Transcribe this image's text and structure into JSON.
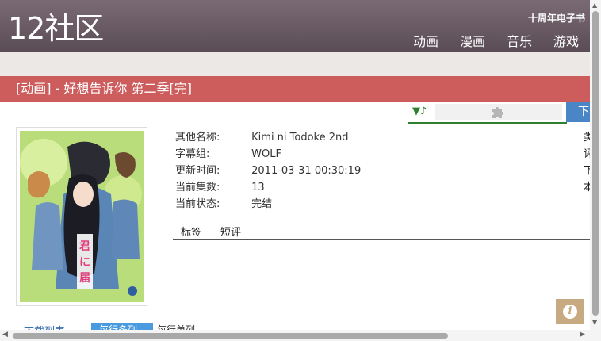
{
  "header": {
    "logo": "12社区",
    "anniversary": "十周年电子书",
    "nav": [
      "动画",
      "漫画",
      "音乐",
      "游戏"
    ]
  },
  "page_title": "[动画] - 好想告诉你 第二季[完]",
  "player": {
    "note_icon": "▼♪",
    "download_cut": "下"
  },
  "details": [
    {
      "label": "其他名称:",
      "value": "Kimi ni Todoke 2nd"
    },
    {
      "label": "字幕组:",
      "value": "WOLF"
    },
    {
      "label": "更新时间:",
      "value": "2011-03-31 00:30:19"
    },
    {
      "label": "当前集数:",
      "value": "13"
    },
    {
      "label": "当前状态:",
      "value": "完结"
    }
  ],
  "right_cut": [
    "类",
    "评",
    "下",
    "本"
  ],
  "tabs": [
    "标签",
    "短评"
  ],
  "lower": {
    "download_list": "下载列表",
    "list_active": "每行多列",
    "list_other": "每行单列"
  },
  "colors": {
    "header": "#6a5a64",
    "title_bar": "#cd5d5d",
    "accent_blue": "#4a86c5"
  }
}
